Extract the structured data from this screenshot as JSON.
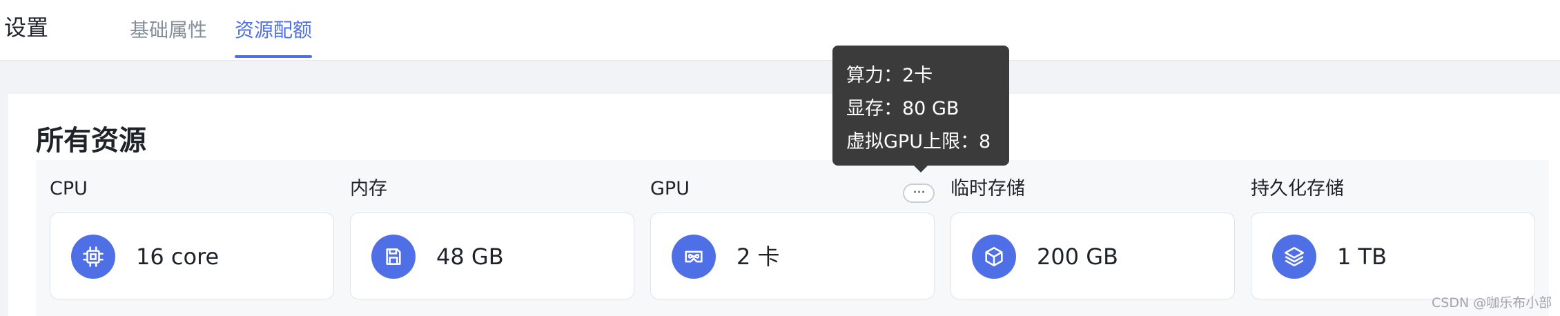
{
  "header": {
    "title": "设置",
    "tabs": [
      {
        "label": "基础属性",
        "active": false
      },
      {
        "label": "资源配额",
        "active": true
      }
    ]
  },
  "section": {
    "title": "所有资源"
  },
  "resources": [
    {
      "label": "CPU",
      "value": "16 core",
      "icon": "chip-icon"
    },
    {
      "label": "内存",
      "value": "48 GB",
      "icon": "memory-icon"
    },
    {
      "label": "GPU",
      "value": "2 卡",
      "icon": "gpu-icon"
    },
    {
      "label": "临时存储",
      "value": "200 GB",
      "icon": "cube-icon"
    },
    {
      "label": "持久化存储",
      "value": "1 TB",
      "icon": "layers-icon"
    }
  ],
  "gpu_more": {
    "label": "···",
    "tooltip": [
      "算力：2卡",
      "显存：80 GB",
      "虚拟GPU上限：8"
    ]
  },
  "watermark": "CSDN @咖乐布小部",
  "colors": {
    "accent": "#4f6fe6",
    "tooltip_bg": "#3b3b3b",
    "page_bg": "#f1f3f6",
    "card_area_bg": "#f7f8fa"
  }
}
